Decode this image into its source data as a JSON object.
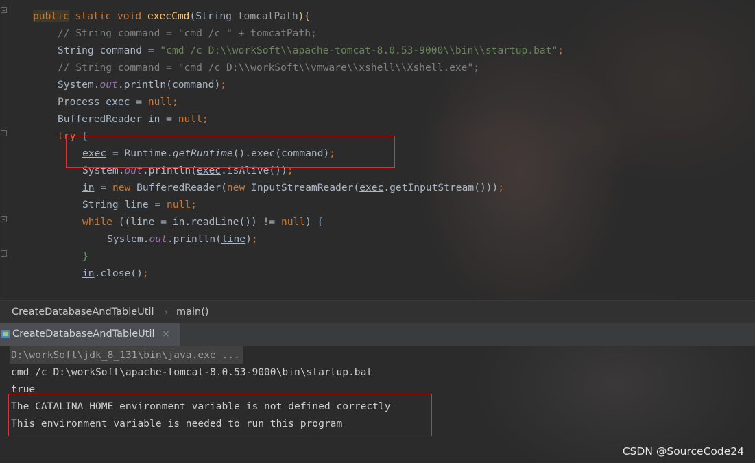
{
  "editor": {
    "lines": [
      {
        "parts": [
          {
            "t": "public",
            "c": "kw pub-hl"
          },
          {
            "t": " static void ",
            "c": "kw"
          },
          {
            "t": "execCmd",
            "c": "fn"
          },
          {
            "t": "(String ",
            "c": ""
          },
          {
            "t": "tomcatPath",
            "c": "param"
          },
          {
            "t": "){",
            "c": "brace-y"
          }
        ]
      },
      {
        "parts": [
          {
            "t": "// String command = \"cmd /c \" + tomcatPath;",
            "c": "cmt"
          }
        ]
      },
      {
        "parts": [
          {
            "t": "String command = ",
            "c": ""
          },
          {
            "t": "\"cmd /c D:\\\\workSoft\\\\apache-tomcat-8.0.53-9000\\\\bin\\\\startup.bat\"",
            "c": "str"
          },
          {
            "t": ";",
            "c": "kw"
          }
        ]
      },
      {
        "parts": [
          {
            "t": "// String command = \"cmd /c D:\\\\workSoft\\\\vmware\\\\xshell\\\\Xshell.exe\";",
            "c": "cmt"
          }
        ]
      },
      {
        "parts": [
          {
            "t": "System.",
            "c": ""
          },
          {
            "t": "out",
            "c": "it"
          },
          {
            "t": ".println(command)",
            "c": ""
          },
          {
            "t": ";",
            "c": "kw"
          }
        ]
      },
      {
        "parts": [
          {
            "t": "Process ",
            "c": ""
          },
          {
            "t": "exec",
            "c": "ul"
          },
          {
            "t": " = ",
            "c": ""
          },
          {
            "t": "null;",
            "c": "kw"
          }
        ]
      },
      {
        "parts": [
          {
            "t": "BufferedReader ",
            "c": ""
          },
          {
            "t": "in",
            "c": "ul"
          },
          {
            "t": " = ",
            "c": ""
          },
          {
            "t": "null;",
            "c": "kw"
          }
        ]
      },
      {
        "parts": [
          {
            "t": "try ",
            "c": "kw"
          },
          {
            "t": "{",
            "c": "brace-b"
          }
        ]
      },
      {
        "parts": [
          {
            "t": "exec",
            "c": "ul"
          },
          {
            "t": " = Runtime.",
            "c": ""
          },
          {
            "t": "getRuntime",
            "c": "itw"
          },
          {
            "t": "().exec(command)",
            "c": ""
          },
          {
            "t": ";",
            "c": "kw"
          }
        ]
      },
      {
        "parts": [
          {
            "t": "System.",
            "c": ""
          },
          {
            "t": "out",
            "c": "it"
          },
          {
            "t": ".println(",
            "c": ""
          },
          {
            "t": "exec",
            "c": "ul"
          },
          {
            "t": ".isAlive())",
            "c": ""
          },
          {
            "t": ";",
            "c": "kw"
          }
        ]
      },
      {
        "parts": [
          {
            "t": "in",
            "c": "ul"
          },
          {
            "t": " = ",
            "c": ""
          },
          {
            "t": "new ",
            "c": "kw"
          },
          {
            "t": "BufferedReader(",
            "c": ""
          },
          {
            "t": "new ",
            "c": "kw"
          },
          {
            "t": "InputStreamReader(",
            "c": ""
          },
          {
            "t": "exec",
            "c": "ul"
          },
          {
            "t": ".getInputStream()))",
            "c": ""
          },
          {
            "t": ";",
            "c": "kw"
          }
        ]
      },
      {
        "parts": [
          {
            "t": "String ",
            "c": ""
          },
          {
            "t": "line",
            "c": "ul"
          },
          {
            "t": " = ",
            "c": ""
          },
          {
            "t": "null;",
            "c": "kw"
          }
        ]
      },
      {
        "parts": [
          {
            "t": "while ",
            "c": "kw"
          },
          {
            "t": "((",
            "c": ""
          },
          {
            "t": "line",
            "c": "ul"
          },
          {
            "t": " = ",
            "c": ""
          },
          {
            "t": "in",
            "c": "ul"
          },
          {
            "t": ".readLine()) != ",
            "c": ""
          },
          {
            "t": "null",
            "c": "kw"
          },
          {
            "t": ") ",
            "c": ""
          },
          {
            "t": "{",
            "c": "brace-b"
          }
        ]
      },
      {
        "parts": [
          {
            "t": "System.",
            "c": ""
          },
          {
            "t": "out",
            "c": "it"
          },
          {
            "t": ".println(",
            "c": ""
          },
          {
            "t": "line",
            "c": "ul"
          },
          {
            "t": ")",
            "c": ""
          },
          {
            "t": ";",
            "c": "kw"
          }
        ]
      },
      {
        "parts": [
          {
            "t": "}",
            "c": "brace-g"
          }
        ]
      },
      {
        "parts": [
          {
            "t": "in",
            "c": "ul"
          },
          {
            "t": ".close()",
            "c": ""
          },
          {
            "t": ";",
            "c": "kw"
          }
        ]
      }
    ]
  },
  "breadcrumb": {
    "class_name": "CreateDatabaseAndTableUtil",
    "separator": "›",
    "method": "main()"
  },
  "run_panel": {
    "tab_label": "CreateDatabaseAndTableUtil",
    "close_glyph": "×",
    "icon": "run-config-icon"
  },
  "console": {
    "lines": [
      "D:\\workSoft\\jdk_8_131\\bin\\java.exe ...",
      "cmd /c D:\\workSoft\\apache-tomcat-8.0.53-9000\\bin\\startup.bat",
      "true",
      "The CATALINA_HOME environment variable is not defined correctly",
      "This environment variable is needed to run this program"
    ]
  },
  "watermark": "CSDN @SourceCode24",
  "colors": {
    "background": "#2b2b2b",
    "keyword": "#cc7832",
    "string": "#6a8759",
    "comment": "#808080",
    "highlight_box": "#d9343c"
  }
}
